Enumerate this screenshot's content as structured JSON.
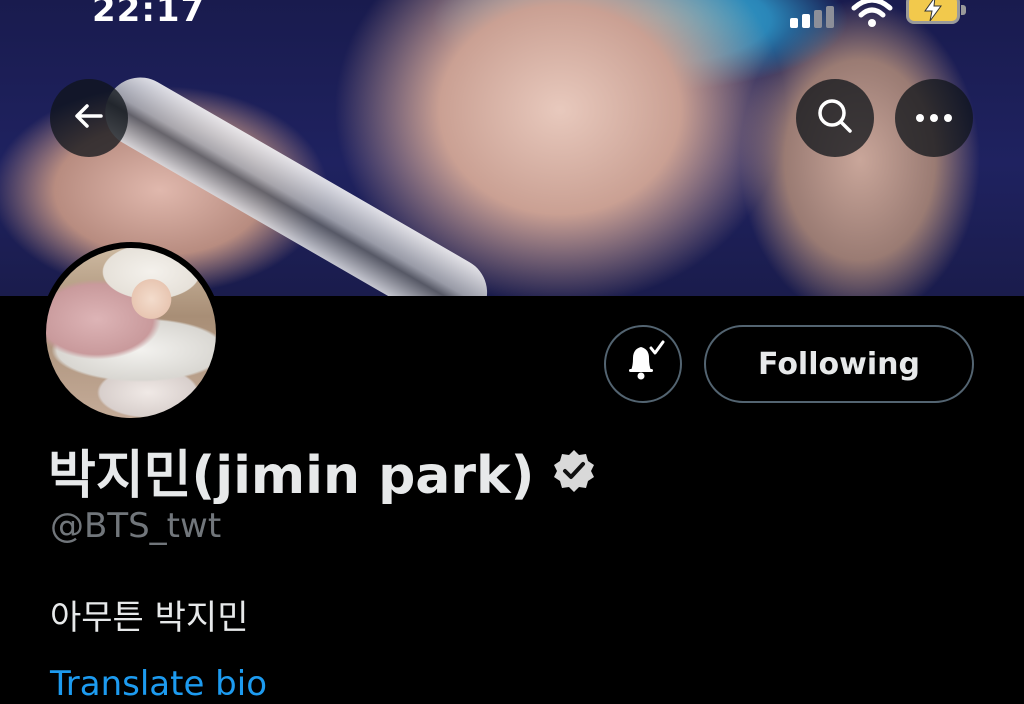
{
  "status_bar": {
    "time": "22:17"
  },
  "header": {
    "back_icon": "arrow-left-icon",
    "search_icon": "search-icon",
    "more_icon": "more-horizontal-icon"
  },
  "profile": {
    "display_name": "박지민(jimin park)",
    "handle": "@BTS_twt",
    "bio": "아무튼 박지민",
    "translate_label": "Translate bio",
    "follow_button_label": "Following",
    "verified_icon": "verified-badge-icon",
    "notify_icon": "bell-check-icon"
  },
  "colors": {
    "background": "#000000",
    "text_primary": "#e7e9ea",
    "text_secondary": "#71767b",
    "link": "#1d9bf0",
    "button_border": "#536471"
  }
}
